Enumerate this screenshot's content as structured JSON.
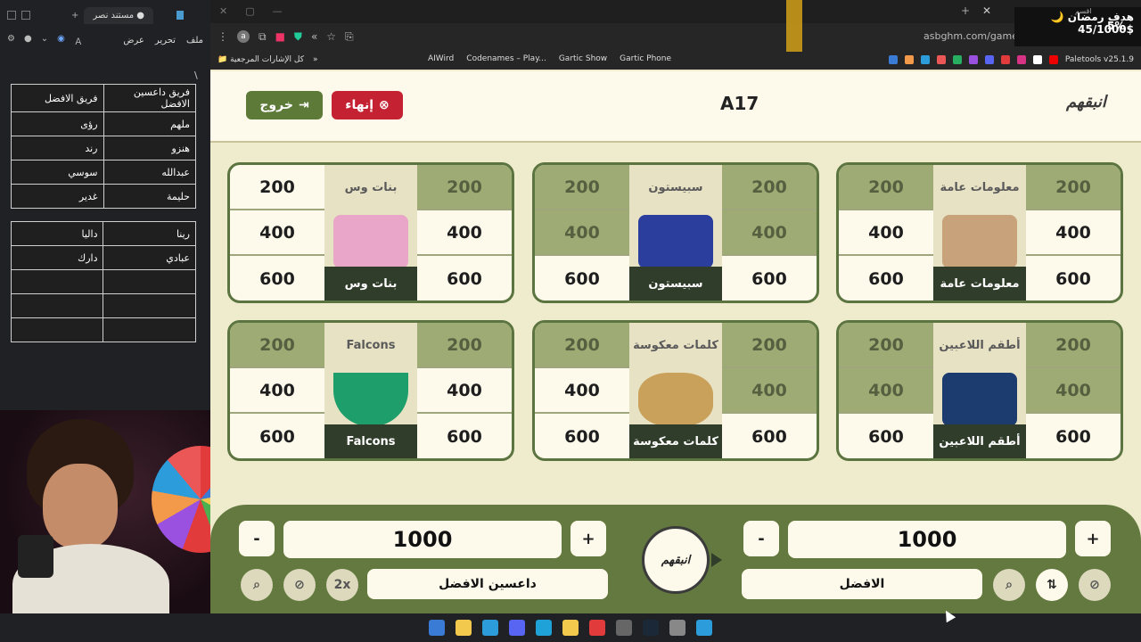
{
  "doc": {
    "tab_title": "مستند نصر",
    "menu": [
      "ملف",
      "تحرير",
      "عرض"
    ],
    "slash": "\\",
    "table1": {
      "rows": [
        [
          "فريق داعسين الافضل",
          "فريق الافضل"
        ],
        [
          "ملهم",
          "رؤى"
        ],
        [
          "هنزو",
          "رند"
        ],
        [
          "عبدالله",
          "سوسي"
        ],
        [
          "حليمة",
          "غدير"
        ]
      ]
    },
    "table2": {
      "rows": [
        [
          "رينا",
          "داليا"
        ],
        [
          "عبادي",
          "دارك"
        ],
        [
          "",
          ""
        ],
        [
          "",
          ""
        ],
        [
          "",
          ""
        ]
      ]
    }
  },
  "browser": {
    "url": "asbghm.com/game/ORE8LO",
    "bookmarks_folder": "كل الإشارات المرجعية",
    "bookmarks": [
      "AIWird",
      "Codenames – Play...",
      "Gartic Show",
      "Gartic Phone",
      "Paletools v25.1.9"
    ],
    "avatar_letter": "a"
  },
  "goal": {
    "title": "هدف رمضان 🌙",
    "amount": "45/1000$",
    "percent": "5%",
    "small": "اقسم"
  },
  "game": {
    "logo": "انبقهم",
    "question_id": "A17",
    "end_label": "إنهاء",
    "exit_label": "خروج",
    "categories": [
      {
        "title": "معلومات عامة",
        "name": "معلومات عامة",
        "left": [
          "200",
          "400",
          "600"
        ],
        "right": [
          "200",
          "400",
          "600"
        ],
        "used_left": [
          true,
          false,
          false
        ],
        "used_right": [
          true,
          false,
          false
        ],
        "picture": "thinking-boy-icon"
      },
      {
        "title": "سبيستون",
        "name": "سبيستون",
        "left": [
          "200",
          "400",
          "600"
        ],
        "right": [
          "200",
          "400",
          "600"
        ],
        "used_left": [
          true,
          true,
          false
        ],
        "used_right": [
          true,
          true,
          false
        ],
        "picture": "spacetoon-logo"
      },
      {
        "title": "بنات وس",
        "name": "بنات وس",
        "left": [
          "200",
          "400",
          "600"
        ],
        "right": [
          "200",
          "400",
          "600"
        ],
        "used_left": [
          false,
          false,
          false
        ],
        "used_right": [
          true,
          false,
          false
        ],
        "picture": "girls-illustration"
      },
      {
        "title": "أطقم اللاعبين",
        "name": "أطقم اللاعبين",
        "left": [
          "200",
          "400",
          "600"
        ],
        "right": [
          "200",
          "400",
          "600"
        ],
        "used_left": [
          true,
          true,
          false
        ],
        "used_right": [
          true,
          true,
          false
        ],
        "picture": "football-team-photo"
      },
      {
        "title": "كلمات معكوسة",
        "name": "كلمات معكوسة",
        "left": [
          "200",
          "400",
          "600"
        ],
        "right": [
          "200",
          "400",
          "600"
        ],
        "used_left": [
          true,
          false,
          false
        ],
        "used_right": [
          true,
          true,
          false
        ],
        "picture": "mirror-icon"
      },
      {
        "title": "Falcons",
        "name": "Falcons",
        "left": [
          "200",
          "400",
          "600"
        ],
        "right": [
          "200",
          "400",
          "600"
        ],
        "used_left": [
          true,
          false,
          false
        ],
        "used_right": [
          true,
          false,
          false
        ],
        "picture": "falcons-logo"
      }
    ],
    "teams": {
      "right": {
        "name": "الافضل",
        "score": "1000"
      },
      "left": {
        "name": "داعسين الافضل",
        "score": "1000"
      }
    },
    "center_logo": "انبقهم",
    "plus": "+",
    "minus": "-",
    "double": "2x"
  }
}
